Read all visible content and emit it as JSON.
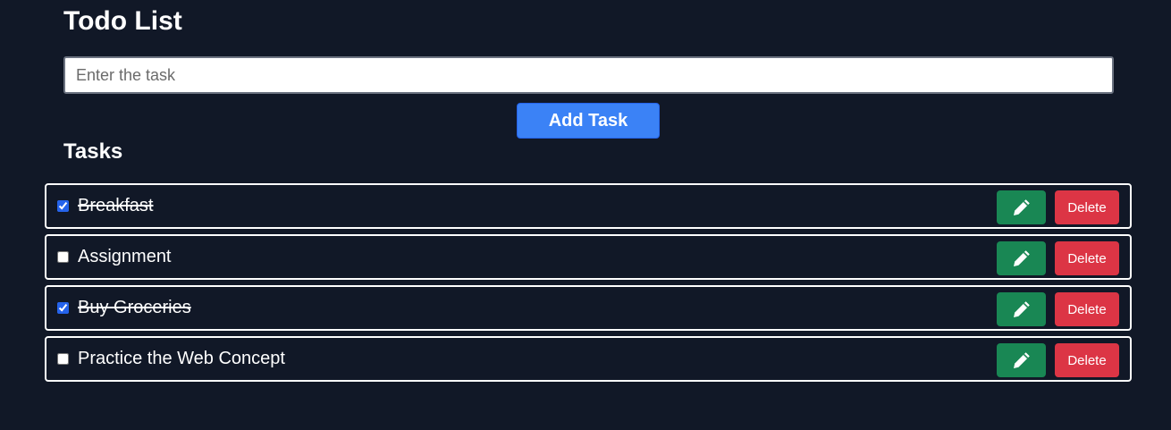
{
  "app": {
    "title": "Todo List"
  },
  "input": {
    "placeholder": "Enter the task",
    "value": ""
  },
  "add_button": {
    "label": "Add Task"
  },
  "tasks_heading": "Tasks",
  "tasks": [
    {
      "text": "Breakfast",
      "completed": true,
      "edit_icon": "pencil-icon",
      "delete_label": "Delete"
    },
    {
      "text": "Assignment",
      "completed": false,
      "edit_icon": "pencil-icon",
      "delete_label": "Delete"
    },
    {
      "text": "Buy Groceries",
      "completed": true,
      "edit_icon": "pencil-icon",
      "delete_label": "Delete"
    },
    {
      "text": "Practice the Web Concept",
      "completed": false,
      "edit_icon": "pencil-icon",
      "delete_label": "Delete"
    }
  ],
  "colors": {
    "background": "#111827",
    "primary_button": "#3b82f6",
    "edit_button": "#198754",
    "delete_button": "#dc3545",
    "text": "#ffffff"
  }
}
